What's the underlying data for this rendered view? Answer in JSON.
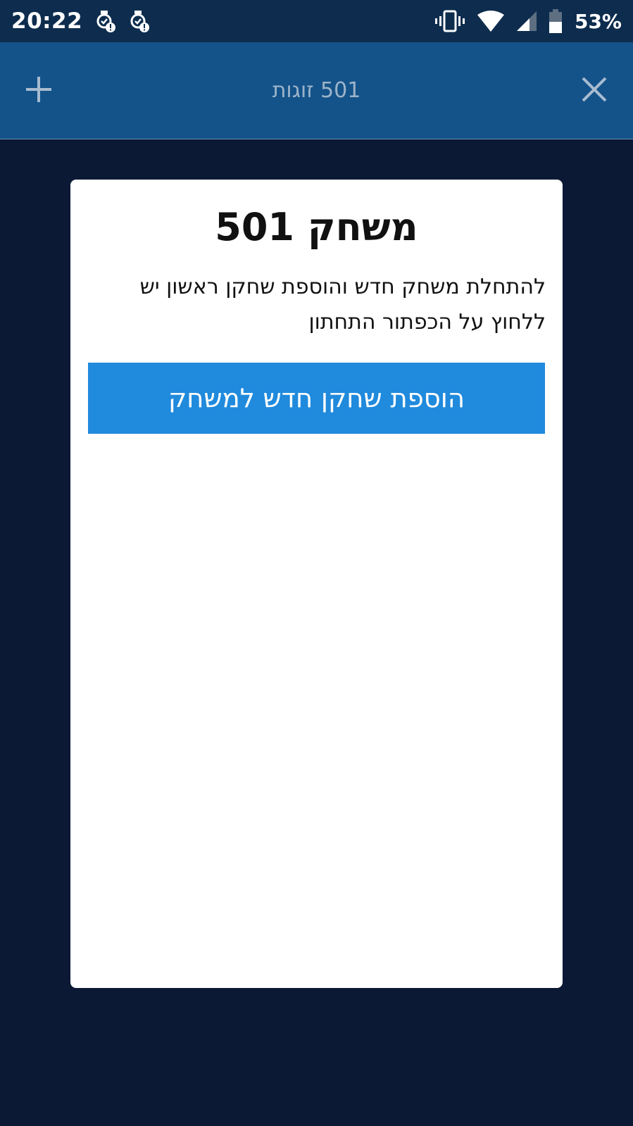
{
  "status_bar": {
    "time": "20:22",
    "battery_percent": "53%",
    "left_icons": [
      "alarm-warning-icon",
      "alarm-warning-icon"
    ],
    "right_icons": [
      "vibrate-icon",
      "wifi-icon",
      "signal-icon",
      "battery-icon"
    ]
  },
  "app_bar": {
    "title": "501 זוגות",
    "left_icon": "plus-icon",
    "right_icon": "close-icon"
  },
  "card": {
    "title": "משחק 501",
    "description": "להתחלת משחק חדש והוספת שחקן ראשון יש ללחוץ על הכפתור התחתון",
    "button_label": "הוספת שחקן חדש למשחק"
  },
  "colors": {
    "background": "#0b1934",
    "status_bar": "#0e2d4e",
    "app_bar": "#14538a",
    "button": "#208add",
    "card": "#ffffff"
  }
}
